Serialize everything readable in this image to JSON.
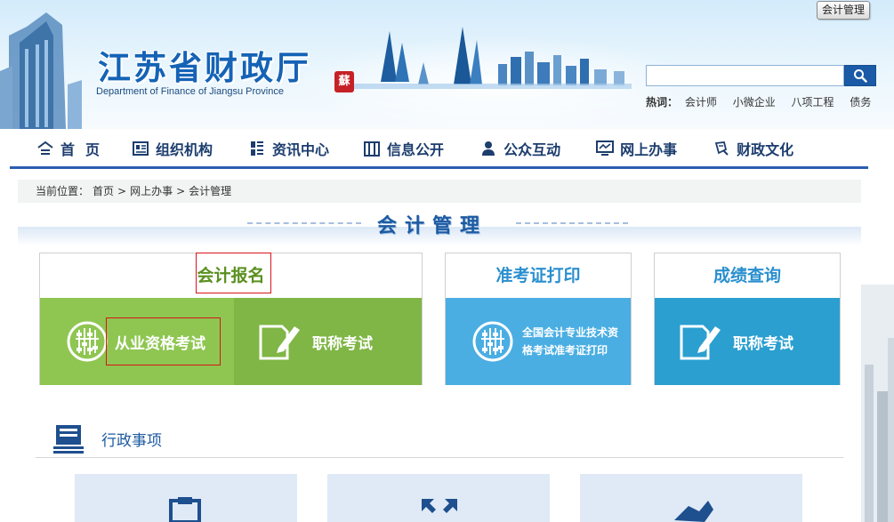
{
  "header": {
    "title": "江苏省财政厅",
    "subtitle": "Department of Finance of Jiangsu Province",
    "seal_text": "蘇",
    "top_button": "会计管理",
    "search": {
      "value": "",
      "placeholder": ""
    },
    "hot_label": "热词：",
    "hot_words": [
      "会计师",
      "小微企业",
      "八项工程",
      "债务"
    ]
  },
  "nav": [
    {
      "label": "首页",
      "icon": "home-icon"
    },
    {
      "label": "组织机构",
      "icon": "id-card-icon"
    },
    {
      "label": "资讯中心",
      "icon": "news-icon"
    },
    {
      "label": "信息公开",
      "icon": "columns-icon"
    },
    {
      "label": "公众互动",
      "icon": "user-icon"
    },
    {
      "label": "网上办事",
      "icon": "monitor-icon"
    },
    {
      "label": "财政文化",
      "icon": "culture-icon"
    }
  ],
  "breadcrumb": {
    "prefix": "当前位置：",
    "items": [
      "首页",
      "网上办事",
      "会计管理"
    ],
    "separator": ">"
  },
  "section_title": "会计管理",
  "cards": {
    "registration": {
      "title": "会计报名",
      "title_color": "#5a8f1f",
      "tiles": [
        {
          "label": "从业资格考试",
          "icon": "abacus-icon",
          "color": "#8ec651"
        },
        {
          "label": "职称考试",
          "icon": "pen-document-icon",
          "color": "#7fb645"
        }
      ]
    },
    "admission": {
      "title": "准考证打印",
      "title_color": "#2a8fcf",
      "tile": {
        "line1": "全国会计专业技术资",
        "line2": "格考试准考证打印",
        "icon": "abacus-icon",
        "color": "#4aaee3"
      }
    },
    "score": {
      "title": "成绩查询",
      "title_color": "#2a8fcf",
      "tile": {
        "label": "职称考试",
        "icon": "pen-document-icon",
        "color": "#2a9fd0"
      }
    }
  },
  "admin": {
    "title": "行政事项",
    "icon": "document-stack-icon",
    "tiles": [
      {
        "icon": "clipboard-icon"
      },
      {
        "icon": "expand-arrows-icon"
      },
      {
        "icon": "bird-icon"
      }
    ]
  }
}
